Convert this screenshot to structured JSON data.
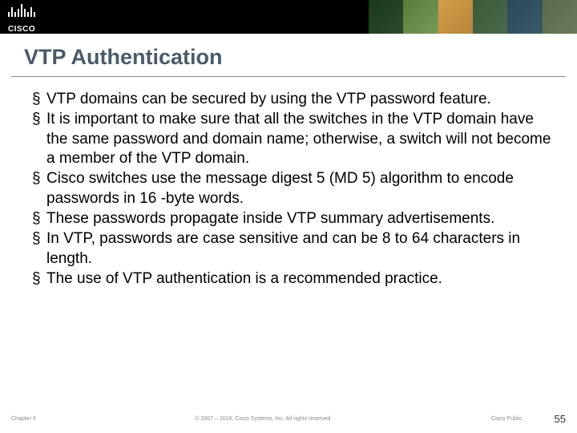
{
  "header": {
    "logo_text": "CISCO"
  },
  "slide": {
    "title": "VTP Authentication",
    "bullets": [
      "VTP domains can be secured by using the VTP password feature.",
      "It is important to make sure that all the switches in the VTP domain have the same password and domain name; otherwise, a switch will not become a member of the VTP domain.",
      "Cisco switches use the message digest 5 (MD 5) algorithm to encode passwords in 16 -byte words.",
      "These passwords propagate inside VTP summary advertisements.",
      "In VTP, passwords are case sensitive and can be 8 to 64 characters in length.",
      "The use of VTP authentication is a recommended practice."
    ]
  },
  "footer": {
    "chapter": "Chapter 3",
    "copyright": "© 2007 – 2016, Cisco Systems, Inc. All rights reserved.",
    "classification": "Cisco Public",
    "page": "55"
  }
}
